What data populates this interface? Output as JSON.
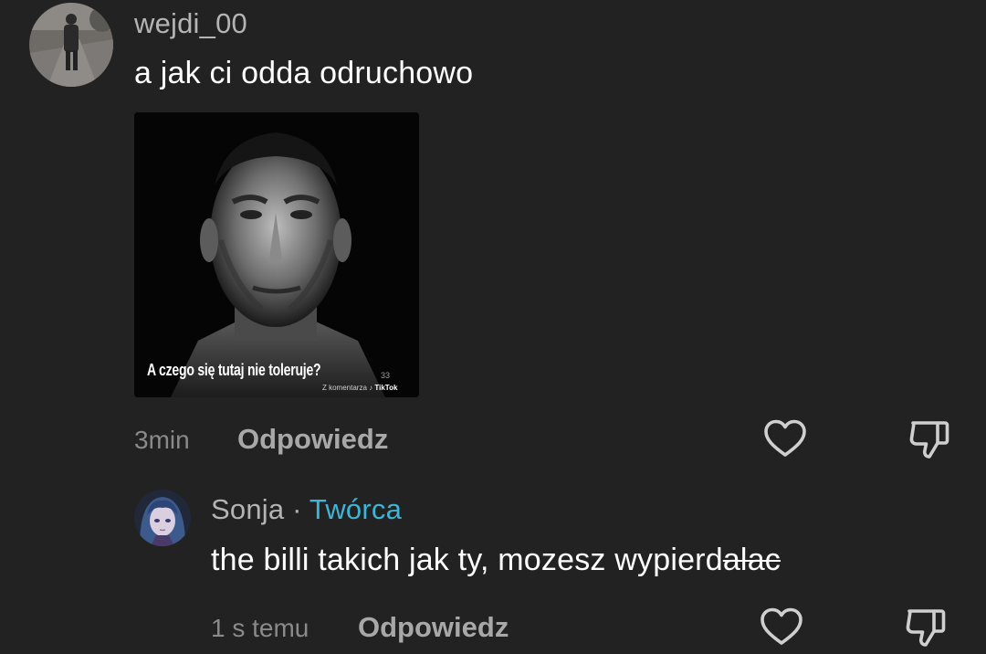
{
  "comments": [
    {
      "username": "wejdi_00",
      "text": "a jak ci odda odruchowo",
      "attachment": {
        "caption": "A czego się tutaj nie toleruje?",
        "watermark_prefix": "Z komentarza",
        "watermark_brand": "TikTok",
        "watermark_user": "33"
      },
      "time": "3min",
      "reply_label": "Odpowiedz",
      "like_icon": "heart-outline-icon",
      "dislike_icon": "thumbs-down-outline-icon"
    },
    {
      "username": "Sonja",
      "separator": "·",
      "role_badge": "Twórca",
      "text_plain": "the billi takich jak ty, mozesz wypierd",
      "text_struck": "alac",
      "time": "1 s temu",
      "reply_label": "Odpowiedz",
      "like_icon": "heart-outline-icon",
      "dislike_icon": "thumbs-down-outline-icon"
    }
  ],
  "colors": {
    "background": "#222222",
    "username": "#b4b4b4",
    "text": "#ffffff",
    "meta": "#8a8a8a",
    "creator_badge": "#3fb4d6"
  }
}
